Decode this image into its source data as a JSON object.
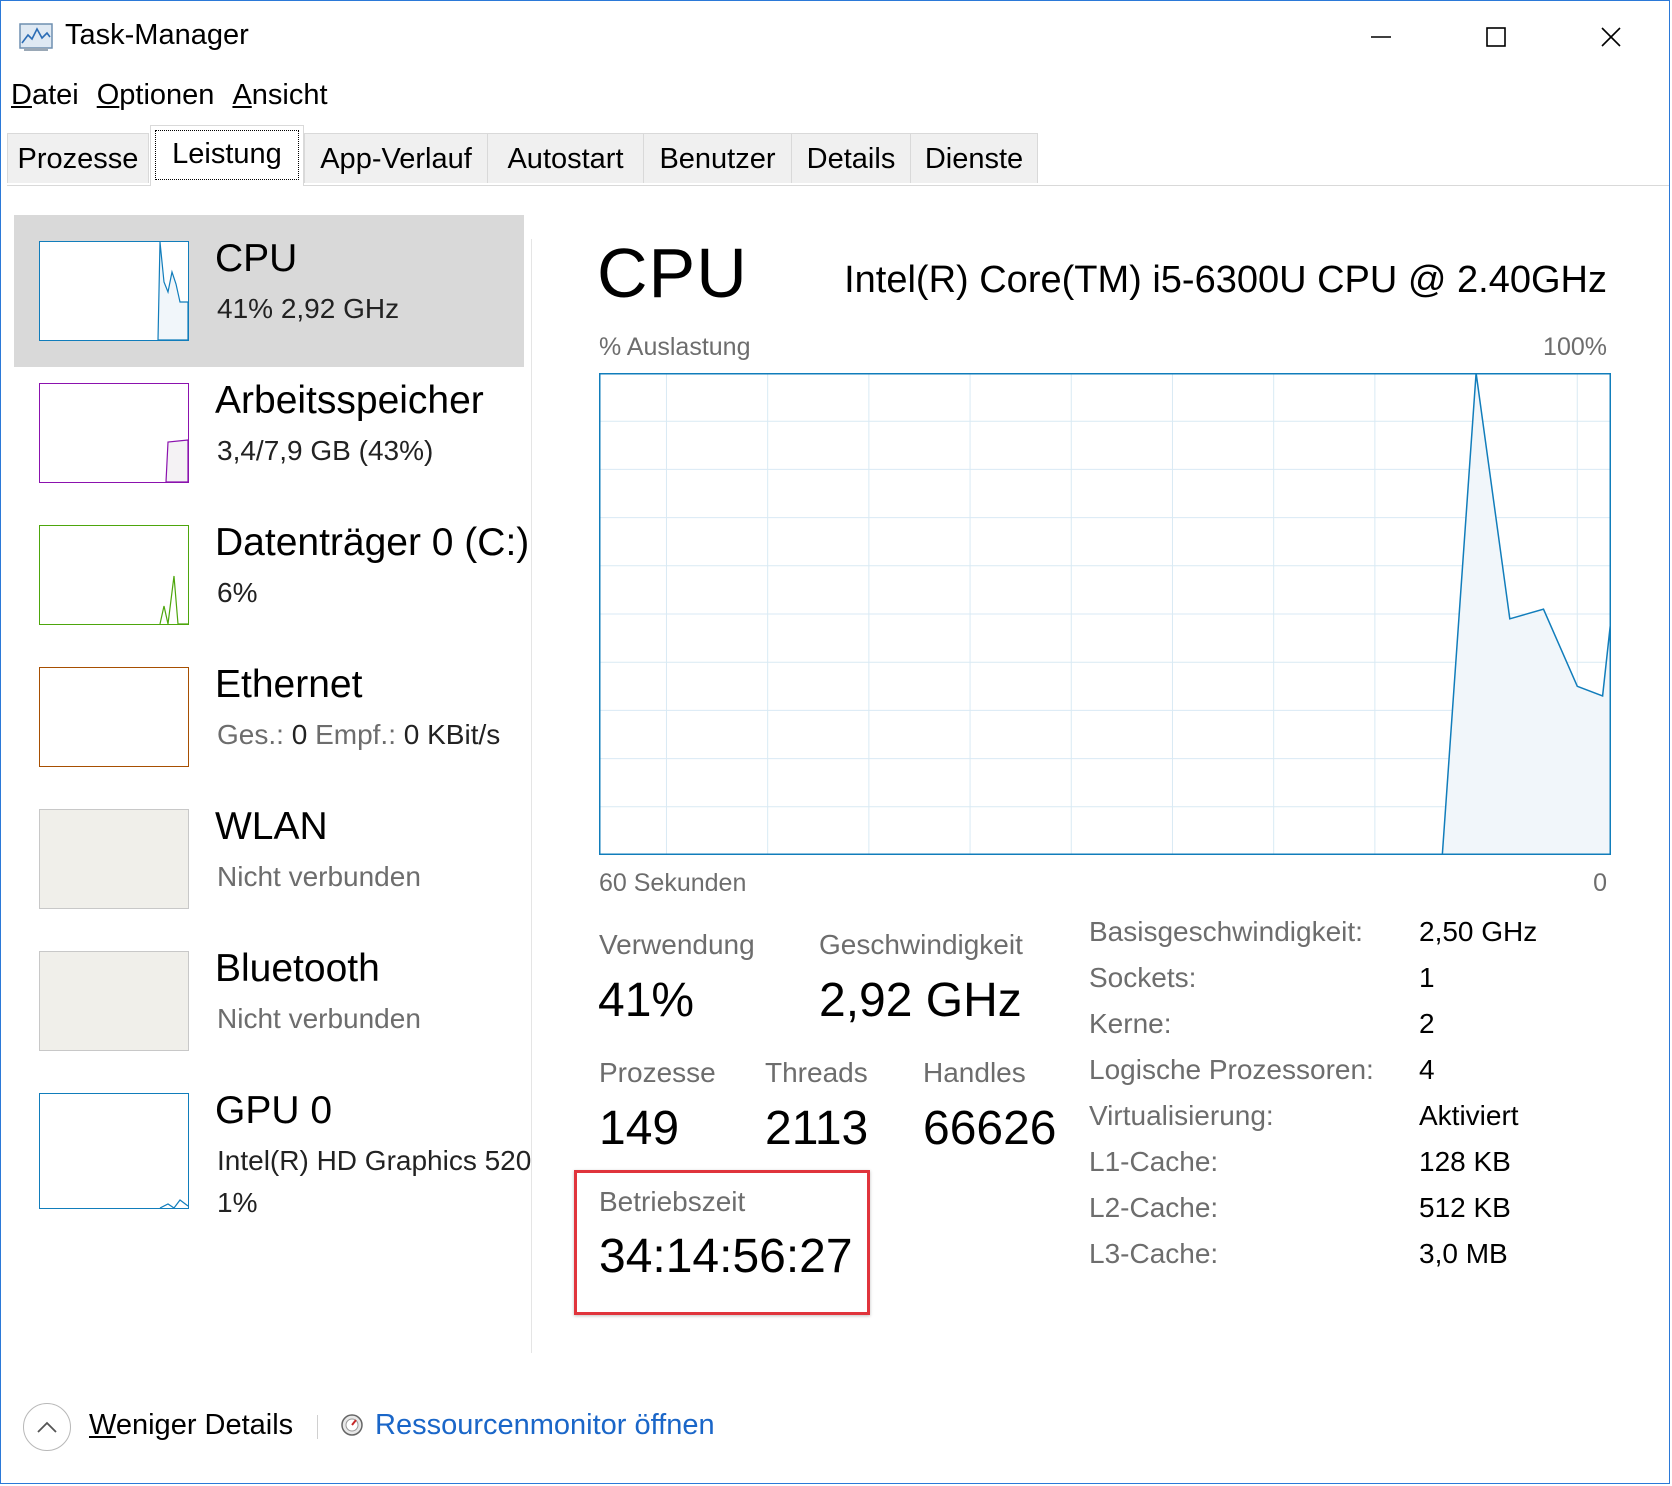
{
  "window": {
    "title": "Task-Manager",
    "icons": {
      "app": "task-manager-icon",
      "minimize": "minimize-icon",
      "maximize": "maximize-icon",
      "close": "close-icon"
    }
  },
  "menu": [
    {
      "accel": "D",
      "rest": "atei"
    },
    {
      "accel": "O",
      "rest": "ptionen"
    },
    {
      "accel": "A",
      "rest": "nsicht"
    }
  ],
  "tabs": [
    "Prozesse",
    "Leistung",
    "App-Verlauf",
    "Autostart",
    "Benutzer",
    "Details",
    "Dienste"
  ],
  "active_tab": "Leistung",
  "sidebar": {
    "cpu": {
      "title": "CPU",
      "sub": "41%  2,92 GHz"
    },
    "memory": {
      "title": "Arbeitsspeicher",
      "sub": "3,4/7,9 GB (43%)"
    },
    "disk": {
      "title": "Datenträger 0 (C:)",
      "sub": "6%"
    },
    "ethernet": {
      "title": "Ethernet",
      "send_label": "Ges.:",
      "send_value": "0",
      "recv_label": "Empf.:",
      "recv_value": "0 KBit/s"
    },
    "wlan": {
      "title": "WLAN",
      "sub": "Nicht verbunden"
    },
    "bluetooth": {
      "title": "Bluetooth",
      "sub": "Nicht verbunden"
    },
    "gpu": {
      "title": "GPU 0",
      "sub": "Intel(R) HD Graphics 520",
      "sub2": "1%"
    }
  },
  "colors": {
    "cpu": "#117dbb",
    "memory": "#8b12ae",
    "disk": "#4da60c",
    "ethernet": "#a74f01",
    "cpu_fill": "#f1f6fa",
    "grid": "#d9eaf4",
    "uptime_border": "#e0343c",
    "link": "#1a66c8"
  },
  "main": {
    "heading": "CPU",
    "model": "Intel(R) Core(TM) i5-6300U CPU @ 2.40GHz",
    "graph": {
      "label": "% Auslastung",
      "max": "100%",
      "time": "60 Sekunden",
      "zero": "0"
    },
    "stats": {
      "usage": {
        "label": "Verwendung",
        "value": "41%"
      },
      "speed": {
        "label": "Geschwindigkeit",
        "value": "2,92 GHz"
      },
      "processes": {
        "label": "Prozesse",
        "value": "149"
      },
      "threads": {
        "label": "Threads",
        "value": "2113"
      },
      "handles": {
        "label": "Handles",
        "value": "66626"
      },
      "uptime": {
        "label": "Betriebszeit",
        "value": "34:14:56:27"
      }
    },
    "info": [
      {
        "label": "Basisgeschwindigkeit:",
        "value": "2,50 GHz"
      },
      {
        "label": "Sockets:",
        "value": "1"
      },
      {
        "label": "Kerne:",
        "value": "2"
      },
      {
        "label": "Logische Prozessoren:",
        "value": "4"
      },
      {
        "label": "Virtualisierung:",
        "value": "Aktiviert"
      },
      {
        "label": "L1-Cache:",
        "value": "128 KB"
      },
      {
        "label": "L2-Cache:",
        "value": "512 KB"
      },
      {
        "label": "L3-Cache:",
        "value": "3,0 MB"
      }
    ]
  },
  "chart_data": {
    "type": "area",
    "x_unit": "seconds ago",
    "xlim": [
      60,
      0
    ],
    "ylim": [
      0,
      100
    ],
    "x": [
      60,
      10,
      8,
      6,
      4,
      2,
      0.5,
      -0.5,
      -1.5,
      -3,
      -4.5,
      -6
    ],
    "values": [
      0,
      0,
      100,
      49,
      51,
      35,
      33,
      65,
      42,
      42,
      41,
      41
    ],
    "grid": true
  },
  "footer": {
    "fewer_details_accel": "W",
    "fewer_details_rest": "eniger Details",
    "resource_monitor": "Ressourcenmonitor öffnen"
  }
}
